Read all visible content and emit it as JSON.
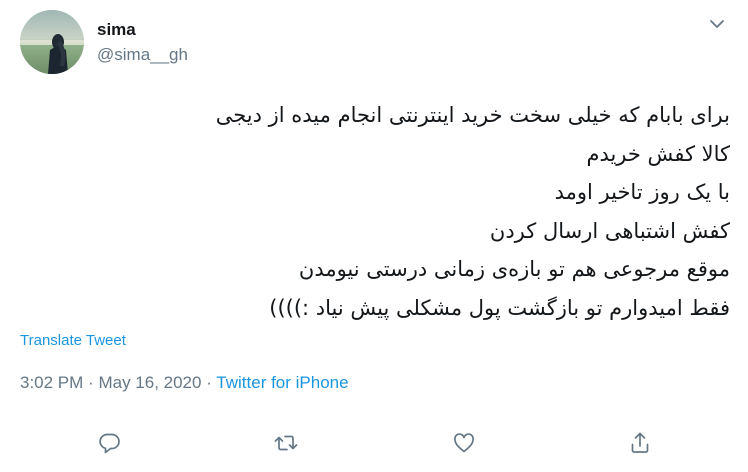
{
  "tweet": {
    "author": {
      "display_name": "sima",
      "handle": "@sima__gh"
    },
    "text_lines": [
      "برای بابام که خیلی سخت خرید اینترنتی انجام میده از دیجی",
      "کالا کفش خریدم",
      "با یک روز تاخیر اومد",
      "کفش اشتباهی ارسال کردن",
      "موقع مرجوعی هم تو بازه‌ی زمانی درستی نیومدن",
      "فقط امیدوارم تو بازگشت پول مشکلی پیش نیاد :))))"
    ],
    "translate_label": "Translate Tweet",
    "time": "3:02 PM",
    "separator1": "·",
    "date": "May 16, 2020",
    "separator2": "·",
    "source": "Twitter for iPhone"
  },
  "icons": {
    "menu": "chevron-down-icon",
    "reply": "reply-icon",
    "retweet": "retweet-icon",
    "like": "like-icon",
    "share": "share-icon"
  },
  "colors": {
    "text": "#14171a",
    "secondary": "#657786",
    "link": "#1b95e0",
    "icon": "#657786"
  }
}
